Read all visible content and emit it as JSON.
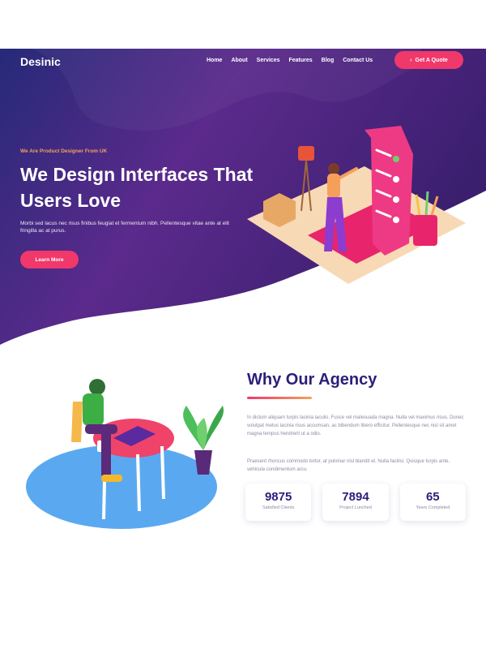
{
  "brand": {
    "logo": "Desinic"
  },
  "nav": {
    "items": [
      "Home",
      "About",
      "Services",
      "Features",
      "Blog",
      "Contact Us"
    ],
    "cta_label": "Get A Quote"
  },
  "hero": {
    "eyebrow": "We Are Product Designer From UK",
    "headline": "We Design Interfaces That Users Love",
    "text": "Morbi sed lacus nec risus finibus feugiat et fermentum nibh. Pellentesque vitae ante at elit fringilla ac at purus.",
    "button_label": "Learn More"
  },
  "agency": {
    "title": "Why Our Agency",
    "paragraph1": "In dictum aliquam turpis lacinia iaculis. Fusce vel malesuada magna. Nulla vel maximus risus. Donec volutpat metus lacinia risus accumsan, ac bibendum libero efficitur. Pellentesque nec nisl sit amet magna tempus hendrerit ut a odio.",
    "paragraph2": "Praesent rhoncus commodo tortor, at pulvinar nisl blandit et. Nulla facilisi. Quisque turpis ante, vehicula condimentum arcu.",
    "stats": [
      {
        "value": "9875",
        "label": "Satisfied Clients"
      },
      {
        "value": "7894",
        "label": "Project Lunched"
      },
      {
        "value": "65",
        "label": "Years Completed"
      }
    ]
  },
  "colors": {
    "hero_start": "#2a2578",
    "hero_end": "#6a2a8e",
    "accent": "#f0386b",
    "title": "#2a1f7a"
  }
}
